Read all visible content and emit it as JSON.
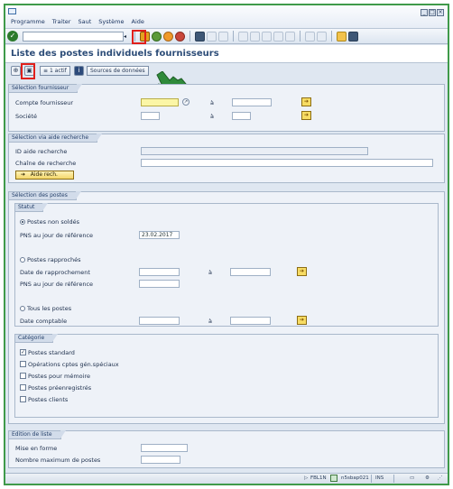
{
  "menu": {
    "items": [
      "Programme",
      "Traiter",
      "Saut",
      "Système",
      "Aide"
    ]
  },
  "title": "Liste des postes individuels fournisseurs",
  "app_toolbar": {
    "filter_btn": "1 actif",
    "sources_btn": "Sources de données"
  },
  "supplier_group": {
    "title": "Sélection fournisseur",
    "rows": [
      {
        "label": "Compte fournisseur",
        "to": "à"
      },
      {
        "label": "Société",
        "to": "à"
      }
    ]
  },
  "search_group": {
    "title": "Sélection via aide recherche",
    "id_label": "ID aide recherche",
    "string_label": "Chaîne de recherche",
    "help_button": "Aide rech."
  },
  "items_group": {
    "title": "Sélection des postes",
    "status": {
      "title": "Statut",
      "open_items": "Postes non soldés",
      "key_date_label": "PNS au jour de référence",
      "key_date_value": "23.02.2017",
      "cleared_items": "Postes rapprochés",
      "clearing_date_label": "Date de rapprochement",
      "clearing_to": "à",
      "cleared_key_date_label": "PNS au jour de référence",
      "all_items": "Tous les postes",
      "posting_date_label": "Date comptable",
      "posting_to": "à"
    },
    "type": {
      "title": "Catégorie",
      "items": [
        {
          "label": "Postes standard",
          "checked": true
        },
        {
          "label": "Opérations cptes gén.spéciaux",
          "checked": false
        },
        {
          "label": "Postes pour mémoire",
          "checked": false
        },
        {
          "label": "Postes préenregistrés",
          "checked": false
        },
        {
          "label": "Postes clients",
          "checked": false
        }
      ]
    }
  },
  "output_group": {
    "title": "Edition de liste",
    "layout_label": "Mise en forme",
    "max_label": "Nombre maximum de postes"
  },
  "statusbar": {
    "tx": "FBL1N",
    "server": "n5sbap021",
    "mode": "INS"
  }
}
